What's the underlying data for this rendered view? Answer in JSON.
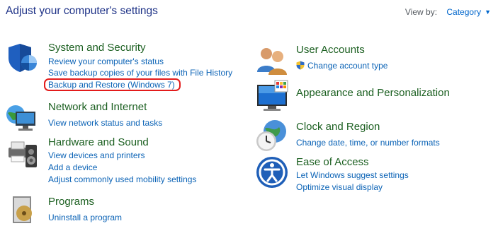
{
  "header": {
    "title": "Adjust your computer's settings",
    "view_by_label": "View by:",
    "view_by_value": "Category"
  },
  "left_categories": [
    {
      "title": "System and Security",
      "icon": "shield-security-icon",
      "links": [
        "Review your computer's status",
        "Save backup copies of your files with File History",
        "Backup and Restore (Windows 7)"
      ]
    },
    {
      "title": "Network and Internet",
      "icon": "network-globe-icon",
      "links": [
        "View network status and tasks"
      ]
    },
    {
      "title": "Hardware and Sound",
      "icon": "printer-speaker-icon",
      "links": [
        "View devices and printers",
        "Add a device",
        "Adjust commonly used mobility settings"
      ]
    },
    {
      "title": "Programs",
      "icon": "programs-disc-icon",
      "links": [
        "Uninstall a program"
      ]
    }
  ],
  "right_categories": [
    {
      "title": "User Accounts",
      "icon": "users-icon",
      "links": [
        "Change account type"
      ]
    },
    {
      "title": "Appearance and Personalization",
      "icon": "monitor-palette-icon",
      "links": []
    },
    {
      "title": "Clock and Region",
      "icon": "clock-globe-icon",
      "links": [
        "Change date, time, or number formats"
      ]
    },
    {
      "title": "Ease of Access",
      "icon": "ease-of-access-icon",
      "links": [
        "Let Windows suggest settings",
        "Optimize visual display"
      ]
    }
  ],
  "colors": {
    "title_blue": "#1e3287",
    "category_green": "#1b5f20",
    "link_blue": "#0b63b6",
    "highlight_red": "#e31b1b"
  }
}
